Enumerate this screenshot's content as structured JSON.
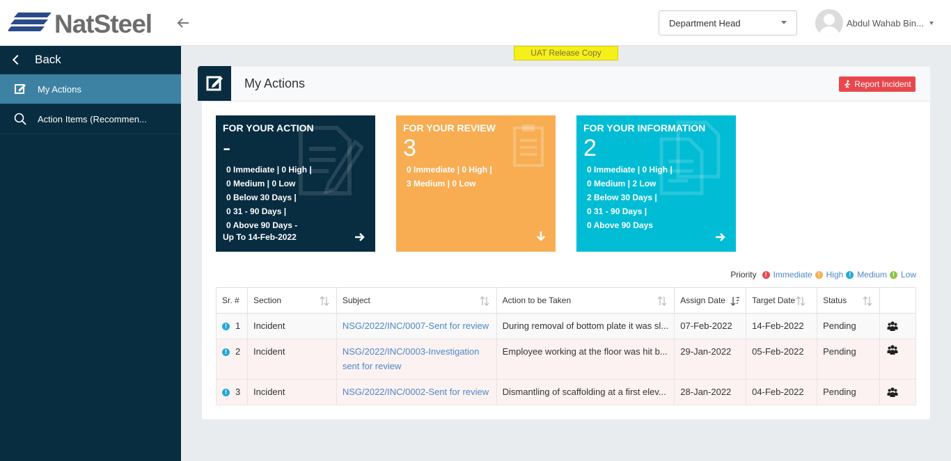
{
  "header": {
    "logo_text": "NatSteel",
    "department": "Department Head",
    "user_name": "Abdul Wahab Bin..."
  },
  "sidebar": {
    "back_label": "Back",
    "items": [
      {
        "label": "My Actions",
        "active": true,
        "icon": "edit-icon"
      },
      {
        "label": "Action Items (Recommen...",
        "active": false,
        "icon": "search-icon"
      }
    ]
  },
  "banner": "UAT Release Copy",
  "page": {
    "title": "My Actions",
    "report_button": "Report Incident"
  },
  "tiles": {
    "action": {
      "title": "FOR YOUR ACTION",
      "count": "-",
      "lines": [
        "0  Immediate | 0  High |",
        "0  Medium | 0  Low",
        "0  Below 30 Days |",
        "0  31 - 90 Days |",
        "0  Above 90 Days  -"
      ],
      "footer": "Up To 14-Feb-2022",
      "color": "#082c40"
    },
    "review": {
      "title": "FOR YOUR REVIEW",
      "count": "3",
      "lines": [
        "0  Immediate | 0  High |",
        "3  Medium | 0  Low"
      ],
      "color": "#f8ad52"
    },
    "info": {
      "title": "FOR YOUR INFORMATION",
      "count": "2",
      "lines": [
        "0  Immediate | 0  High |",
        "0  Medium | 2  Low",
        "2  Below 30 Days |",
        "0  31 - 90 Days |",
        "0  Above 90 Days"
      ],
      "color": "#00bcd4"
    }
  },
  "priority_legend": {
    "label": "Priority",
    "items": [
      {
        "label": "Immediate",
        "color": "#e9474d"
      },
      {
        "label": "High",
        "color": "#f8ad52"
      },
      {
        "label": "Medium",
        "color": "#23a9d6"
      },
      {
        "label": "Low",
        "color": "#8bc34a"
      }
    ]
  },
  "table": {
    "columns": [
      "Sr. #",
      "Section",
      "Subject",
      "Action to be Taken",
      "Assign Date",
      "Target Date",
      "Status",
      ""
    ],
    "rows": [
      {
        "sr": "1",
        "section": "Incident",
        "subject": "NSG/2022/INC/0007-Sent for review",
        "action": "During removal of bottom plate it was sl...",
        "assign": "07-Feb-2022",
        "target": "14-Feb-2022",
        "status": "Pending"
      },
      {
        "sr": "2",
        "section": "Incident",
        "subject": "NSG/2022/INC/0003-Investigation sent for review",
        "action": "Employee working at the floor was hit b...",
        "assign": "29-Jan-2022",
        "target": "05-Feb-2022",
        "status": "Pending"
      },
      {
        "sr": "3",
        "section": "Incident",
        "subject": "NSG/2022/INC/0002-Sent for review",
        "action": "Dismantling of scaffolding at a first elev...",
        "assign": "28-Jan-2022",
        "target": "04-Feb-2022",
        "status": "Pending"
      }
    ]
  }
}
